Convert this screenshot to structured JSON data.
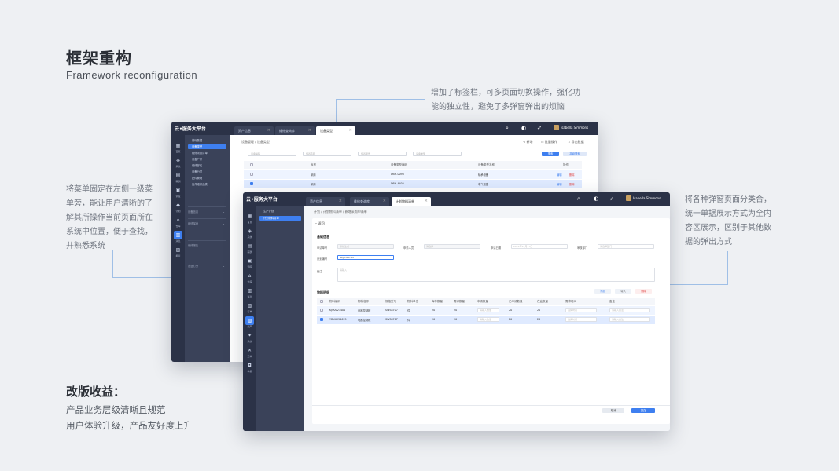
{
  "heading": {
    "title": "框架重构",
    "subtitle": "Framework reconfiguration"
  },
  "notes": {
    "tabs": [
      "增加了标签栏，可多页面切换操作，强化功",
      "能的独立性，避免了多弹窗弹出的烦恼"
    ],
    "menu": [
      "将菜单固定在左侧一级菜",
      "单旁，能让用户清晰的了",
      "解其所操作当前页面所在",
      "系统中位置，便于查找，",
      "并熟悉系统"
    ],
    "modal": [
      "将各种弹窗页面分类合，",
      "统一单据展示方式为全内",
      "容区展示，区别于其他数",
      "据的弹出方式"
    ]
  },
  "benefits": {
    "title": "改版收益：",
    "items": [
      "产品业务层级清晰且规范",
      "用户体验升级，产品友好度上升"
    ]
  },
  "back_window": {
    "logo": "云•服务大平台",
    "tabs": [
      {
        "label": "资产信息"
      },
      {
        "label": "维修查询库"
      },
      {
        "label": "设备类型"
      }
    ],
    "user": "Isabella Simmons",
    "rail": [
      "首页",
      "系统",
      "薪酬",
      "调度",
      "计划",
      "仓库",
      "消息",
      "报表"
    ],
    "menu_title": "基础数据",
    "menu": [
      "设备类型",
      "维修项目清单",
      "设备厂家",
      "维修部位",
      "设备分类",
      "配件管理",
      "备件维修品类"
    ],
    "menu_groups": [
      "设备信息",
      "维修保养",
      "维修报告",
      "出运打分"
    ],
    "breadcrumb": "设备管理 / 设备类型",
    "toolbar": [
      "新增",
      "批量操作",
      "导出数据"
    ],
    "filters": [
      "设备编码",
      "保养名称",
      "保养型号",
      "设备类型"
    ],
    "search_btn": "搜索",
    "reset_btn": "高级搜索",
    "columns": [
      "序号",
      "设备类型编码",
      "设备类型名称",
      "操作"
    ],
    "rows": [
      {
        "name": "采用",
        "code": "DBH-0090",
        "type": "轴承设备",
        "ops": [
          "编辑",
          "删除"
        ]
      },
      {
        "name": "采用",
        "code": "DBH-4402",
        "type": "电气设备",
        "ops": [
          "编辑",
          "删除"
        ]
      }
    ]
  },
  "front_window": {
    "logo": "云•服务大平台",
    "tabs": [
      {
        "label": "资产信息"
      },
      {
        "label": "维修查询库"
      },
      {
        "label": "计划物料清单"
      }
    ],
    "user": "Isabella Simmons",
    "rail": [
      "首页",
      "系统",
      "薪酬",
      "调度",
      "仓库",
      "消息",
      "订单",
      "资产",
      "系统",
      "工单",
      "单据"
    ],
    "menu": [
      "生产计划",
      "计划物料清单"
    ],
    "breadcrumb": "计划 / 计划物料清单 / 新增采购申请单",
    "back": "返回",
    "section1": "基础信息",
    "form": [
      {
        "label": "申请单号",
        "placeholder": "系统生成"
      },
      {
        "label": "申请人员",
        "placeholder": "请选择"
      },
      {
        "label": "申请日期",
        "placeholder": "2021年12月17日"
      },
      {
        "label": "审核部门",
        "placeholder": "请选择部门"
      }
    ],
    "plan_label": "计划编号",
    "plan_value": "SCJH-00795",
    "remark_label": "备注",
    "remark_ph": "请输入",
    "section2": "物料明细",
    "actions": [
      "添加",
      "导入",
      "删除"
    ],
    "columns": [
      "物料编码",
      "物料名称",
      "规格型号",
      "物料单位",
      "库存数量",
      "需求数量",
      "申请数量",
      "已申请数量",
      "在途数量",
      "需求时间",
      "备注"
    ],
    "rows": [
      {
        "code": "KJU0023401",
        "name": "电器控制柜",
        "spec": "SWS8707",
        "unit": "件",
        "stock": "20",
        "need": "20",
        "apply": "请输入数量",
        "applied": "20",
        "transit": "20",
        "time": "选择时间",
        "remark": "请输入备注"
      },
      {
        "code": "YDU0254025",
        "name": "电器控制柜",
        "spec": "SWS8707",
        "unit": "件",
        "stock": "20",
        "need": "20",
        "apply": "请输入数量",
        "applied": "20",
        "transit": "20",
        "time": "选择时间",
        "remark": "请输入备注"
      }
    ],
    "cancel": "取消",
    "submit": "提交"
  },
  "colors": {
    "accent": "#3e7ff0",
    "nav_dark": "#2b3247",
    "nav_mid": "#3a4259",
    "danger": "#e04848"
  }
}
